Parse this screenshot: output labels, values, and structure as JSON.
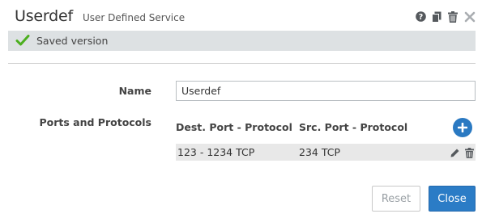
{
  "header": {
    "title": "Userdef",
    "subtitle": "User Defined Service",
    "icons": [
      "help-icon",
      "copy-icon",
      "trash-icon",
      "close-icon"
    ]
  },
  "status": {
    "text": "Saved version",
    "icon": "check-icon",
    "color": "#4caf1f"
  },
  "form": {
    "name_label": "Name",
    "name_value": "Userdef",
    "ports_label": "Ports and Protocols",
    "columns": {
      "dest": "Dest. Port - Protocol",
      "src": "Src. Port - Protocol"
    },
    "rows": [
      {
        "dest": "123 - 1234 TCP",
        "src": "234 TCP"
      }
    ]
  },
  "buttons": {
    "reset": "Reset",
    "close": "Close"
  },
  "colors": {
    "accent": "#2b7cc6",
    "status_bar": "#dde1e3",
    "row_bg": "#e8e8e8"
  }
}
